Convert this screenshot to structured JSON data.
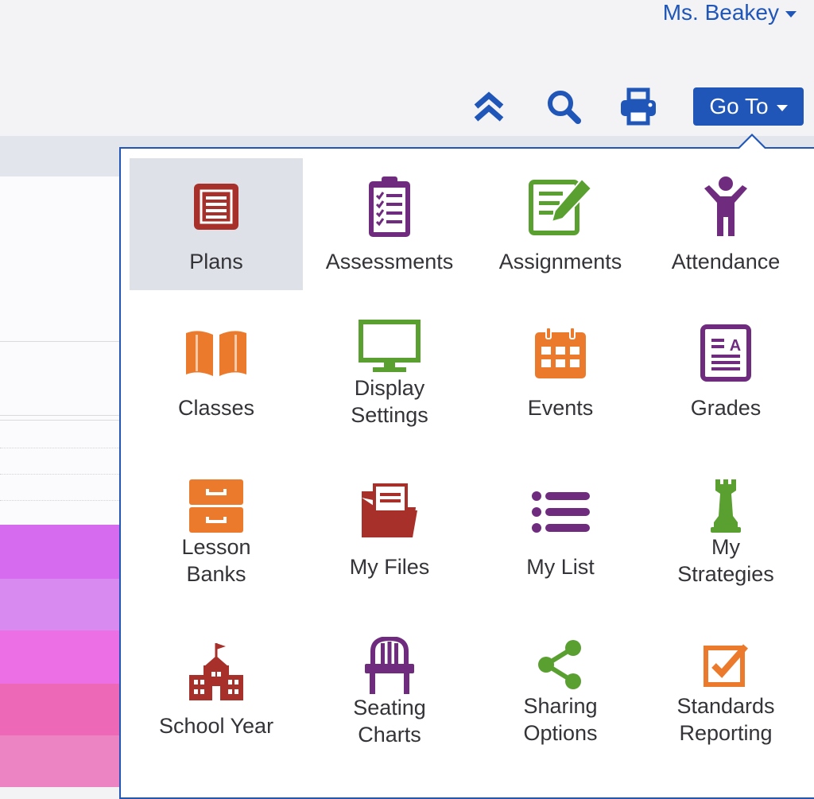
{
  "header": {
    "user_name": "Ms. Beakey"
  },
  "toolbar": {
    "collapse_icon": "double-chevron-up-icon",
    "search_icon": "search-icon",
    "print_icon": "printer-icon",
    "goto_label": "Go To"
  },
  "colors": {
    "accent": "#1f56b8",
    "red": "#a8302a",
    "purple": "#6f2c7f",
    "green": "#5aa031",
    "orange": "#ec7a2c"
  },
  "menu": {
    "items": [
      {
        "label": "Plans",
        "icon": "plans-icon"
      },
      {
        "label": "Assessments",
        "icon": "clipboard-checklist-icon"
      },
      {
        "label": "Assignments",
        "icon": "pencil-edit-icon"
      },
      {
        "label": "Attendance",
        "icon": "person-icon"
      },
      {
        "label": "Classes",
        "icon": "open-book-icon"
      },
      {
        "label": "Display\nSettings",
        "icon": "monitor-icon"
      },
      {
        "label": "Events",
        "icon": "calendar-icon"
      },
      {
        "label": "Grades",
        "icon": "grade-sheet-icon"
      },
      {
        "label": "Lesson\nBanks",
        "icon": "file-cabinet-icon"
      },
      {
        "label": "My Files",
        "icon": "folder-icon"
      },
      {
        "label": "My List",
        "icon": "list-icon"
      },
      {
        "label": "My\nStrategies",
        "icon": "chess-rook-icon"
      },
      {
        "label": "School Year",
        "icon": "school-building-icon"
      },
      {
        "label": "Seating\nCharts",
        "icon": "chair-icon"
      },
      {
        "label": "Sharing\nOptions",
        "icon": "share-icon"
      },
      {
        "label": "Standards\nReporting",
        "icon": "checkbox-icon"
      }
    ]
  }
}
